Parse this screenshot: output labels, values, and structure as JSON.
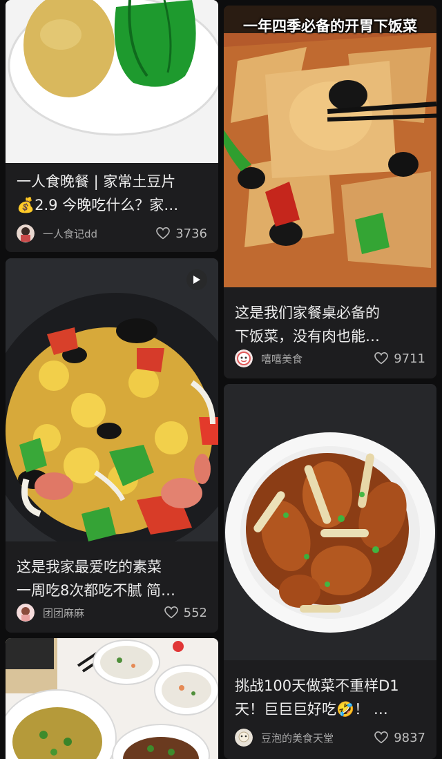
{
  "cards": [
    {
      "title_line1": "一人食晚餐 | 家常土豆片",
      "title_line2": "💰2.9 今晚吃什么？家…",
      "author": "一人食记dd",
      "likes": "3736"
    },
    {
      "overlay": "一年四季必备的开胃下饭菜",
      "title_line1": "这是我们家餐桌必备的",
      "title_line2": "下饭菜，没有肉也能…",
      "author": "嘻嘻美食",
      "likes": "9711"
    },
    {
      "title_line1": "这是我家最爱吃的素菜",
      "title_line2": "一周吃8次都吃不腻 简…",
      "author": "团团麻麻",
      "likes": "552"
    },
    {
      "title_line1": "挑战100天做菜不重样D1",
      "title_line2": "天！巨巨巨好吃🤣！ …",
      "author": "豆泡的美食天堂",
      "likes": "9837"
    }
  ]
}
